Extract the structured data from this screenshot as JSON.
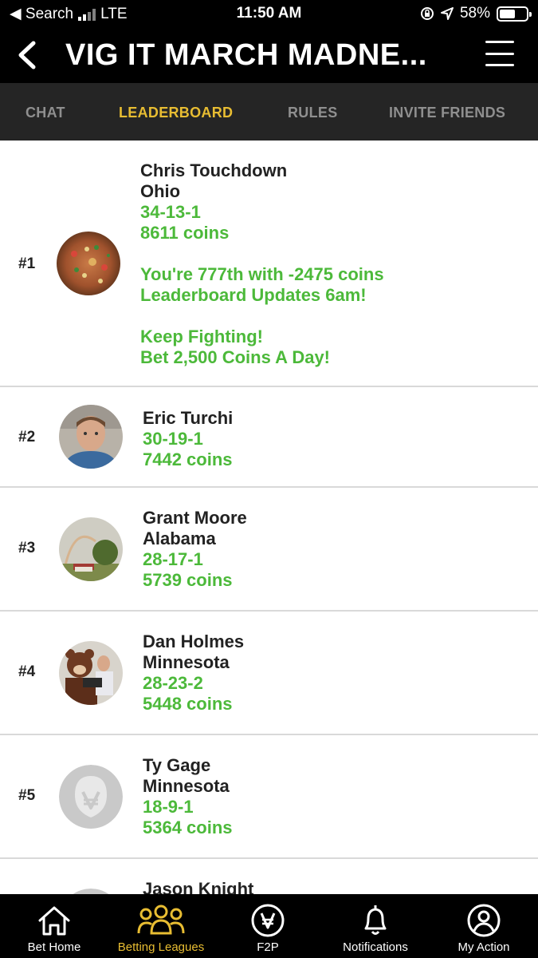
{
  "status_bar": {
    "back_app": "◀ Search",
    "network": "LTE",
    "time": "11:50 AM",
    "battery": "58%",
    "battery_level": 0.58
  },
  "header": {
    "title": "VIG IT MARCH MADNE..."
  },
  "tabs": [
    {
      "label": "CHAT",
      "active": false
    },
    {
      "label": "LEADERBOARD",
      "active": true
    },
    {
      "label": "RULES",
      "active": false
    },
    {
      "label": "INVITE FRIENDS",
      "active": false
    }
  ],
  "leaderboard": {
    "rows": [
      {
        "rank": "#1",
        "name": "Chris Touchdown",
        "location": "Ohio",
        "record": "34-13-1",
        "coins": "8611 coins",
        "message_lines": [
          "You're 777th with -2475 coins",
          "Leaderboard Updates 6am!"
        ],
        "message_lines_2": [
          "Keep Fighting!",
          "Bet 2,500 Coins A Day!"
        ]
      },
      {
        "rank": "#2",
        "name": "Eric Turchi",
        "location": "",
        "record": "30-19-1",
        "coins": "7442 coins"
      },
      {
        "rank": "#3",
        "name": "Grant Moore",
        "location": "Alabama",
        "record": "28-17-1",
        "coins": "5739 coins"
      },
      {
        "rank": "#4",
        "name": "Dan Holmes",
        "location": "Minnesota",
        "record": "28-23-2",
        "coins": "5448 coins"
      },
      {
        "rank": "#5",
        "name": "Ty Gage",
        "location": "Minnesota",
        "record": "18-9-1",
        "coins": "5364 coins"
      },
      {
        "rank": "",
        "name": "Jason Knight",
        "location": "",
        "record": "",
        "coins": ""
      }
    ]
  },
  "bottom_nav": [
    {
      "label": "Bet Home",
      "icon": "home-icon",
      "active": false
    },
    {
      "label": "Betting Leagues",
      "icon": "group-icon",
      "active": true
    },
    {
      "label": "F2P",
      "icon": "vig-coin-icon",
      "active": false
    },
    {
      "label": "Notifications",
      "icon": "bell-icon",
      "active": false
    },
    {
      "label": "My Action",
      "icon": "profile-icon",
      "active": false
    }
  ],
  "colors": {
    "accent": "#e8bd32",
    "green": "#4cb93a",
    "header_bg": "#000000",
    "tab_bg": "#252525"
  }
}
